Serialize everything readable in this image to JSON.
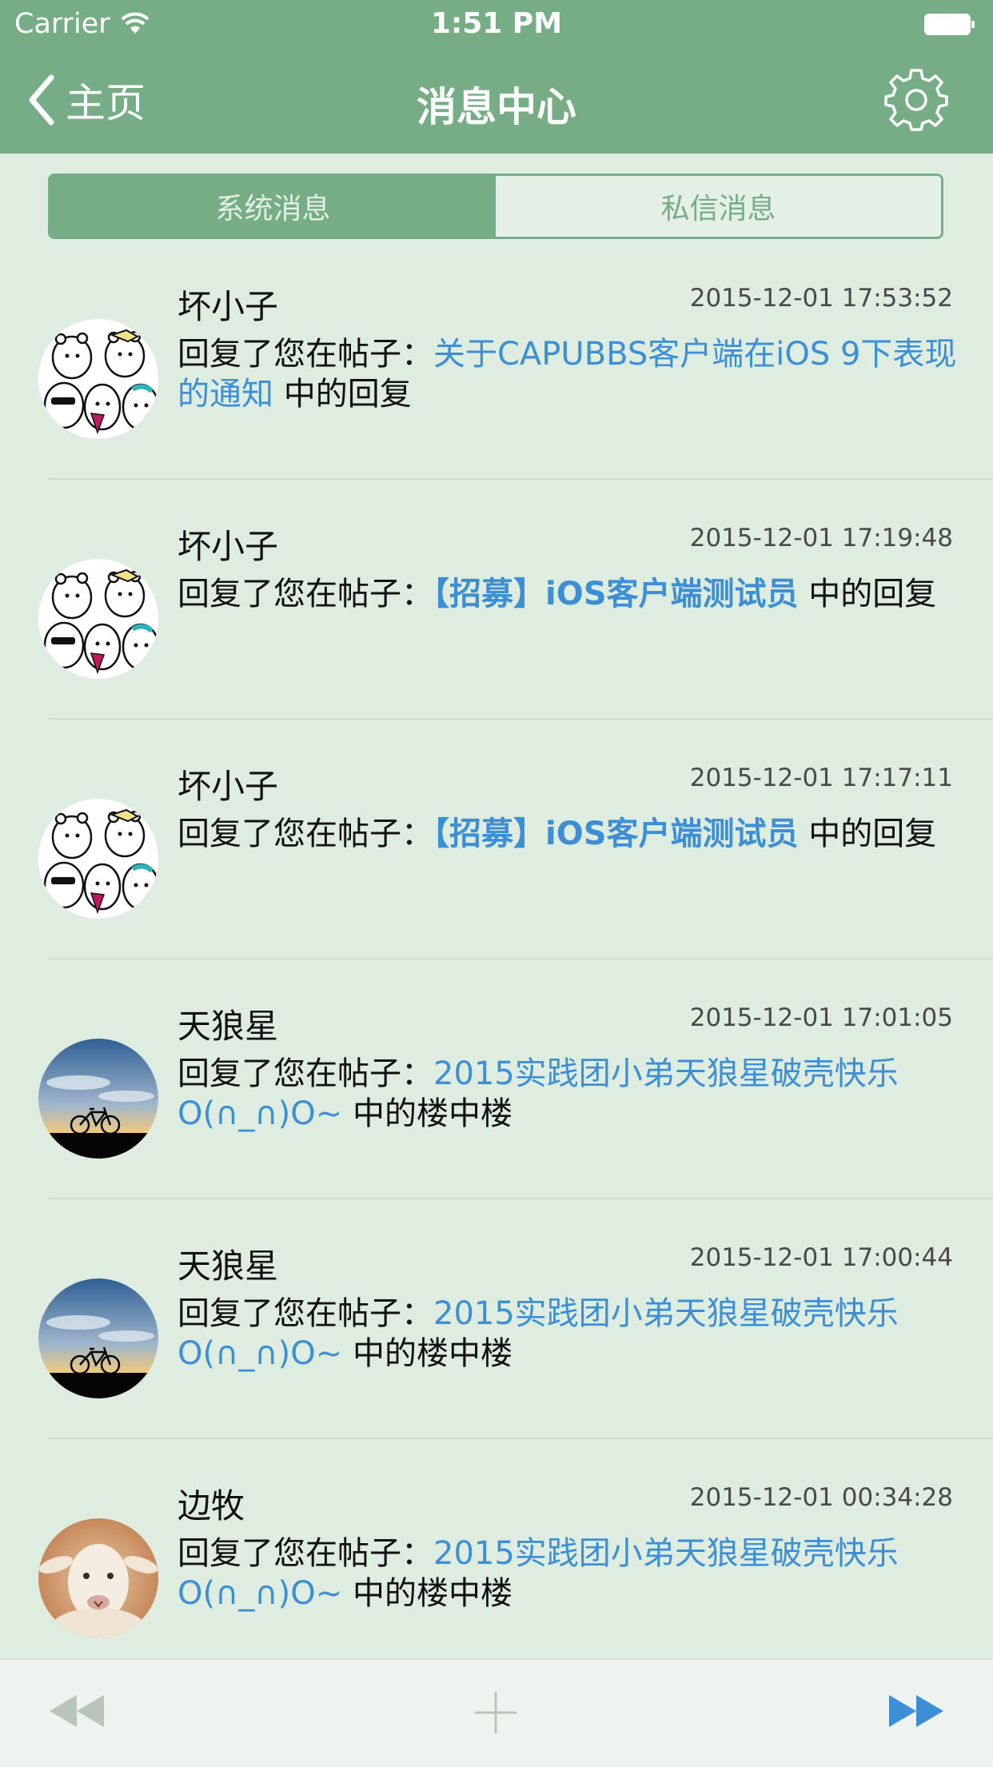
{
  "status_bar": {
    "carrier": "Carrier",
    "time": "1:51 PM"
  },
  "nav": {
    "back_label": "主页",
    "title": "消息中心"
  },
  "tabs": [
    {
      "label": "系统消息",
      "active": true
    },
    {
      "label": "私信消息",
      "active": false
    }
  ],
  "messages": [
    {
      "name": "坏小子",
      "time": "2015-12-01 17:53:52",
      "prefix": "回复了您在帖子：",
      "link": "关于CAPUBBS客户端在iOS 9下表现的通知",
      "suffix": " 中的回复",
      "avatar": "bears-avatar"
    },
    {
      "name": "坏小子",
      "time": "2015-12-01 17:19:48",
      "prefix": "回复了您在帖子：",
      "link": "【招募】iOS客户端测试员",
      "suffix": " 中的回复",
      "avatar": "bears-avatar"
    },
    {
      "name": "坏小子",
      "time": "2015-12-01 17:17:11",
      "prefix": "回复了您在帖子：",
      "link": "【招募】iOS客户端测试员",
      "suffix": " 中的回复",
      "avatar": "bears-avatar"
    },
    {
      "name": "天狼星",
      "time": "2015-12-01 17:01:05",
      "prefix": "回复了您在帖子：",
      "link": "2015实践团小弟天狼星破壳快乐O(∩_∩)O~",
      "suffix": " 中的楼中楼",
      "avatar": "bicycle-sunset-avatar"
    },
    {
      "name": "天狼星",
      "time": "2015-12-01 17:00:44",
      "prefix": "回复了您在帖子：",
      "link": "2015实践团小弟天狼星破壳快乐O(∩_∩)O~",
      "suffix": " 中的楼中楼",
      "avatar": "bicycle-sunset-avatar"
    },
    {
      "name": "边牧",
      "time": "2015-12-01 00:34:28",
      "prefix": "回复了您在帖子：",
      "link": "2015实践团小弟天狼星破壳快乐O(∩_∩)O~",
      "suffix": " 中的楼中楼",
      "avatar": "sheep-avatar"
    }
  ],
  "toolbar": {
    "icons": [
      "rewind-icon",
      "plus-icon",
      "fast-forward-icon"
    ]
  },
  "colors": {
    "nav": "#76ad86",
    "background": "#dfece0",
    "link": "#3c8fd6"
  }
}
